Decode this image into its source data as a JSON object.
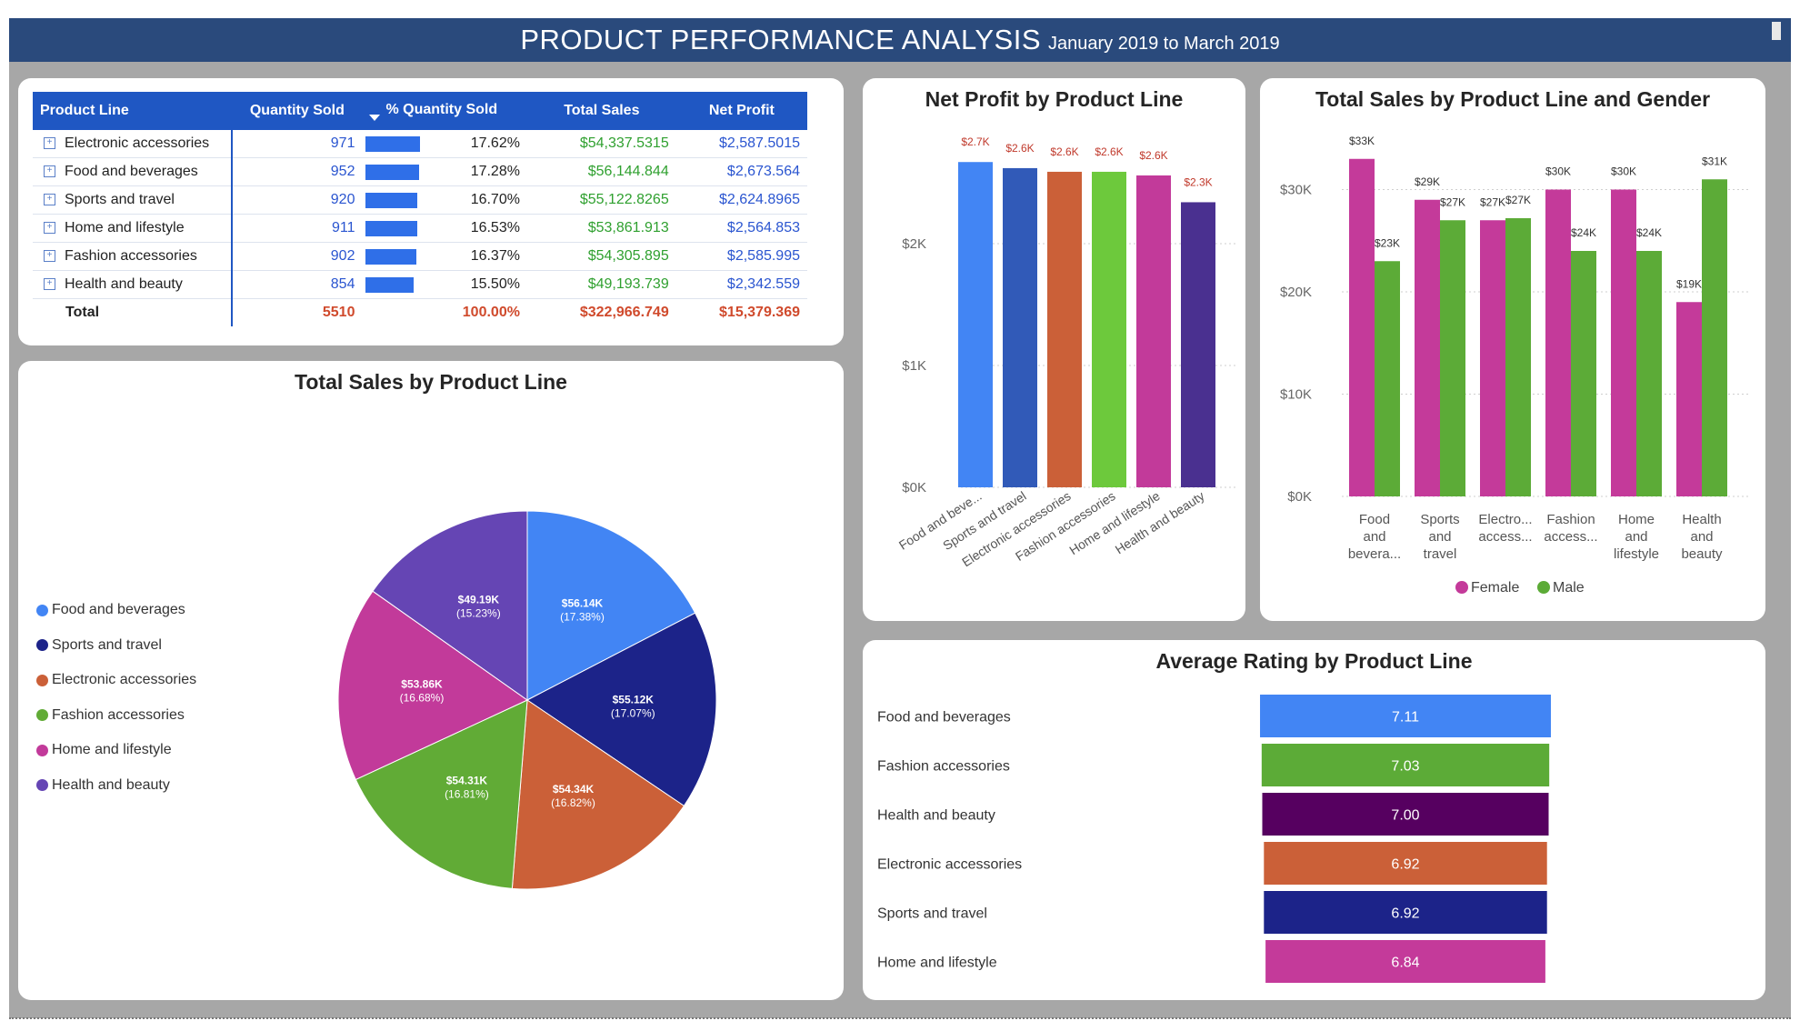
{
  "header": {
    "title": "PRODUCT PERFORMANCE ANALYSIS",
    "subtitle": "January 2019 to March 2019"
  },
  "table": {
    "columns": [
      "Product Line",
      "Quantity Sold",
      "% Quantity Sold",
      "Total Sales",
      "Net Profit"
    ],
    "rows": [
      {
        "product": "Electronic accessories",
        "qty": "971",
        "pct": "17.62%",
        "pct_value": 17.62,
        "sales": "$54,337.5315",
        "profit": "$2,587.5015"
      },
      {
        "product": "Food and beverages",
        "qty": "952",
        "pct": "17.28%",
        "pct_value": 17.28,
        "sales": "$56,144.844",
        "profit": "$2,673.564"
      },
      {
        "product": "Sports and travel",
        "qty": "920",
        "pct": "16.70%",
        "pct_value": 16.7,
        "sales": "$55,122.8265",
        "profit": "$2,624.8965"
      },
      {
        "product": "Home and lifestyle",
        "qty": "911",
        "pct": "16.53%",
        "pct_value": 16.53,
        "sales": "$53,861.913",
        "profit": "$2,564.853"
      },
      {
        "product": "Fashion accessories",
        "qty": "902",
        "pct": "16.37%",
        "pct_value": 16.37,
        "sales": "$54,305.895",
        "profit": "$2,585.995"
      },
      {
        "product": "Health and beauty",
        "qty": "854",
        "pct": "15.50%",
        "pct_value": 15.5,
        "sales": "$49,193.739",
        "profit": "$2,342.559"
      }
    ],
    "total": {
      "label": "Total",
      "qty": "5510",
      "pct": "100.00%",
      "sales": "$322,966.749",
      "profit": "$15,379.369"
    }
  },
  "pie": {
    "title": "Total Sales by Product Line",
    "legend": [
      {
        "name": "Food and beverages",
        "color": "#4285f4"
      },
      {
        "name": "Sports and travel",
        "color": "#1c2389"
      },
      {
        "name": "Electronic accessories",
        "color": "#cb6038"
      },
      {
        "name": "Fashion accessories",
        "color": "#61ab36"
      },
      {
        "name": "Home and lifestyle",
        "color": "#c23a9a"
      },
      {
        "name": "Health and beauty",
        "color": "#6545b4"
      }
    ]
  },
  "net_profit": {
    "title": "Net Profit by Product Line",
    "yticks": [
      "$0K",
      "$1K",
      "$2K"
    ]
  },
  "gender": {
    "title": "Total Sales by Product Line and Gender",
    "yticks": [
      "$0K",
      "$10K",
      "$20K",
      "$30K"
    ],
    "legend": [
      {
        "name": "Female",
        "color": "#c43a9a"
      },
      {
        "name": "Male",
        "color": "#5cab37"
      }
    ]
  },
  "rating": {
    "title": "Average Rating by Product Line"
  },
  "chart_data": [
    {
      "type": "pie",
      "title": "Total Sales by Product Line",
      "slices": [
        {
          "name": "Food and beverages",
          "value": 56.14,
          "label": "$56.14K",
          "pct": "(17.38%)",
          "color": "#4285f4"
        },
        {
          "name": "Sports and travel",
          "value": 55.12,
          "label": "$55.12K",
          "pct": "(17.07%)",
          "color": "#1c2389"
        },
        {
          "name": "Electronic accessories",
          "value": 54.34,
          "label": "$54.34K",
          "pct": "(16.82%)",
          "color": "#cb6038"
        },
        {
          "name": "Fashion accessories",
          "value": 54.31,
          "label": "$54.31K",
          "pct": "(16.81%)",
          "color": "#61ab36"
        },
        {
          "name": "Home and lifestyle",
          "value": 53.86,
          "label": "$53.86K",
          "pct": "(16.68%)",
          "color": "#c23a9a"
        },
        {
          "name": "Health and beauty",
          "value": 49.19,
          "label": "$49.19K",
          "pct": "(15.23%)",
          "color": "#6545b4"
        }
      ]
    },
    {
      "type": "bar",
      "title": "Net Profit by Product Line",
      "categories": [
        "Food and beve...",
        "Sports and travel",
        "Electronic accessories",
        "Fashion accessories",
        "Home and lifestyle",
        "Health and beauty"
      ],
      "values": [
        2.67,
        2.62,
        2.59,
        2.59,
        2.56,
        2.34
      ],
      "labels": [
        "$2.7K",
        "$2.6K",
        "$2.6K",
        "$2.6K",
        "$2.6K",
        "$2.3K"
      ],
      "colors": [
        "#4285f4",
        "#315ab8",
        "#cb6038",
        "#6dc93c",
        "#c23a9a",
        "#4a3090"
      ],
      "ylim": [
        0,
        3
      ]
    },
    {
      "type": "bar",
      "title": "Total Sales by Product Line and Gender",
      "categories": [
        [
          "Food",
          "and",
          "bevera..."
        ],
        [
          "Sports",
          "and",
          "travel"
        ],
        [
          "Electro...",
          "access..."
        ],
        [
          "Fashion",
          "access..."
        ],
        [
          "Home",
          "and",
          "lifestyle"
        ],
        [
          "Health",
          "and",
          "beauty"
        ]
      ],
      "series": [
        {
          "name": "Female",
          "values": [
            33,
            29,
            27,
            30,
            30,
            19
          ],
          "labels": [
            "$33K",
            "$29K",
            "$27K",
            "$30K",
            "$30K",
            "$19K"
          ],
          "color": "#c43a9a"
        },
        {
          "name": "Male",
          "values": [
            23,
            27,
            27.2,
            24,
            24,
            31
          ],
          "labels": [
            "$23K",
            "$27K",
            "$27K",
            "$24K",
            "$24K",
            "$31K"
          ],
          "color": "#5cab37"
        }
      ],
      "ylim": [
        0,
        35
      ]
    },
    {
      "type": "bar",
      "orientation": "horizontal",
      "title": "Average Rating by Product Line",
      "categories": [
        "Food and beverages",
        "Fashion accessories",
        "Health and beauty",
        "Electronic accessories",
        "Sports and travel",
        "Home and lifestyle"
      ],
      "values": [
        7.11,
        7.03,
        7.0,
        6.92,
        6.92,
        6.84
      ],
      "labels": [
        "7.11",
        "7.03",
        "7.00",
        "6.92",
        "6.92",
        "6.84"
      ],
      "colors": [
        "#4285f4",
        "#5cab37",
        "#560060",
        "#cb6038",
        "#1c2389",
        "#c43a9a"
      ]
    }
  ]
}
